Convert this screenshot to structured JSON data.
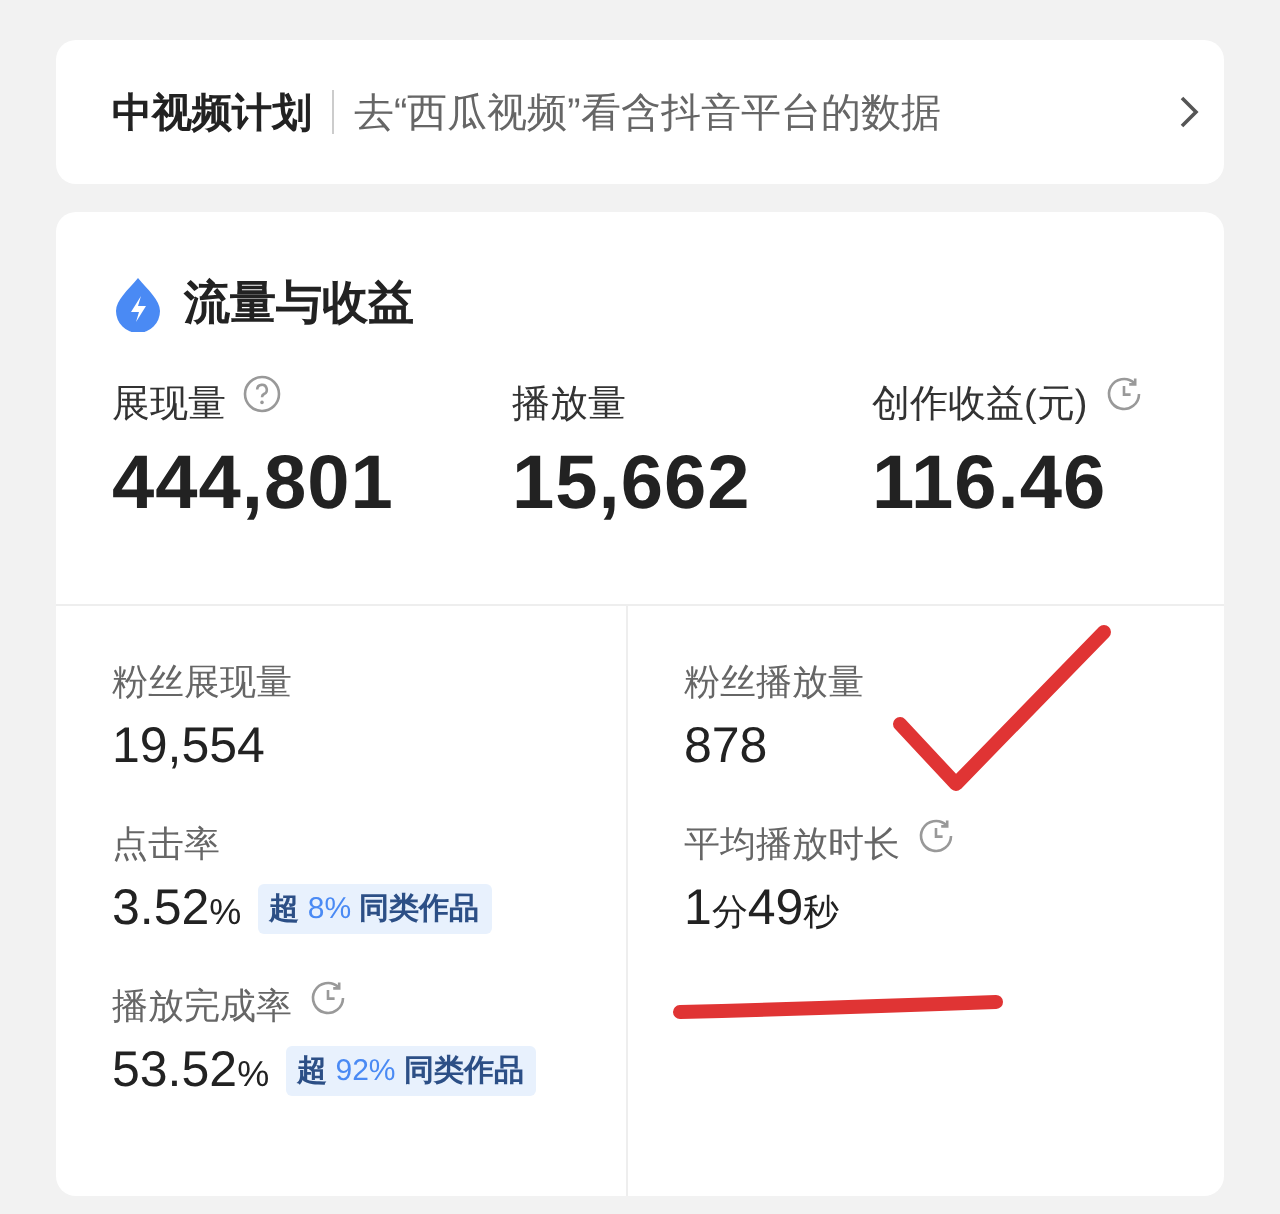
{
  "banner": {
    "title": "中视频计划",
    "link": "去“西瓜视频”看含抖音平台的数据"
  },
  "section": {
    "title": "流量与收益",
    "metrics": [
      {
        "label": "展现量",
        "kind": "help",
        "value": "444,801"
      },
      {
        "label": "播放量",
        "kind": "plain",
        "value": "15,662"
      },
      {
        "label": "创作收益(元)",
        "kind": "history",
        "value": "116.46"
      }
    ]
  },
  "columns": [
    [
      {
        "label": "粉丝展现量",
        "value": [
          {
            "text": "19,554",
            "kind": "num"
          }
        ]
      },
      {
        "label": "点击率",
        "value": [
          {
            "text": "3.52",
            "kind": "num"
          },
          {
            "text": "%",
            "kind": "unit"
          }
        ],
        "badge": {
          "prefix": "超",
          "percent": "8%",
          "suffix": "同类作品"
        }
      },
      {
        "label": "播放完成率",
        "kind": "history",
        "value": [
          {
            "text": "53.52",
            "kind": "num"
          },
          {
            "text": "%",
            "kind": "unit"
          }
        ],
        "badge": {
          "prefix": "超",
          "percent": "92%",
          "suffix": "同类作品"
        }
      }
    ],
    [
      {
        "label": "粉丝播放量",
        "value": [
          {
            "text": "878",
            "kind": "num"
          }
        ]
      },
      {
        "label": "平均播放时长",
        "kind": "history",
        "value": [
          {
            "text": "1",
            "kind": "num"
          },
          {
            "text": "分",
            "kind": "unit"
          },
          {
            "text": "49",
            "kind": "num"
          },
          {
            "text": "秒",
            "kind": "unit"
          }
        ]
      }
    ]
  ]
}
